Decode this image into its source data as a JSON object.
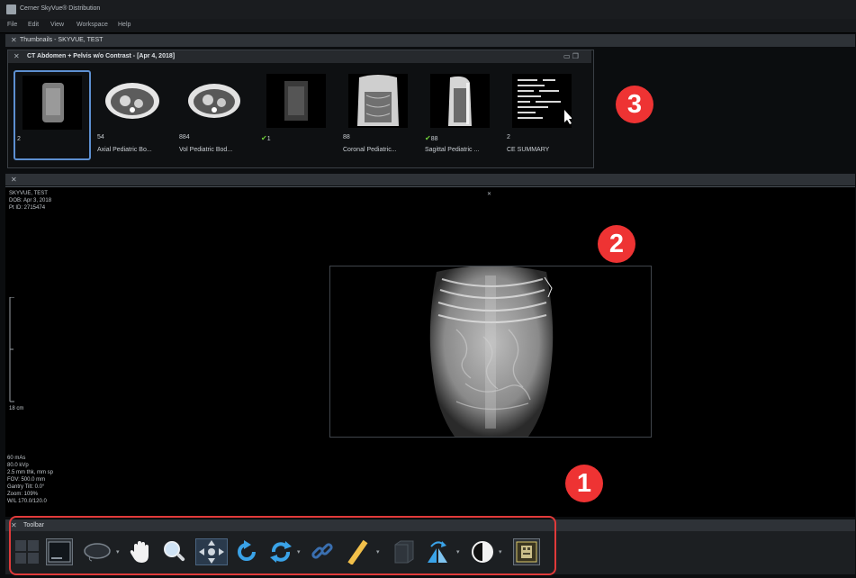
{
  "window": {
    "title": "Cerner SkyVue® Distribution"
  },
  "menu": [
    "File",
    "Edit",
    "View",
    "Workspace",
    "Help"
  ],
  "thumbnails_tab": {
    "label": "Thumbnails - SKYVUE, TEST"
  },
  "study": {
    "title": "CT Abdomen + Pelvis w/o Contrast - [Apr 4, 2018]"
  },
  "series": [
    {
      "count": "2",
      "label": "",
      "checked": false
    },
    {
      "count": "54",
      "label": "Axial Pediatric Bo...",
      "checked": false
    },
    {
      "count": "884",
      "label": "Vol Pediatric Bod...",
      "checked": false
    },
    {
      "count": "1",
      "label": "",
      "checked": true
    },
    {
      "count": "88",
      "label": "Coronal Pediatric...",
      "checked": false
    },
    {
      "count": "88",
      "label": "Sagittal Pediatric ...",
      "checked": true
    },
    {
      "count": "2",
      "label": "CE SUMMARY",
      "checked": false
    }
  ],
  "patient": {
    "name": "SKYVUE, TEST",
    "dob": "DOB: Apr 3, 2018",
    "pt_id": "Pt ID: 2715474"
  },
  "viewer": {
    "scale_label": "18 cm",
    "acquisition": [
      "60 mAs",
      "80.0 kVp",
      "2.5 mm thk, mm sp",
      "FOV: 500.0 mm",
      "Gantry Tilt: 0.0°",
      "Zoom: 109%",
      "W/L 170.0/120.0"
    ]
  },
  "toolbar": {
    "label": "Toolbar",
    "tools": [
      "layout-grid-icon",
      "single-view-icon",
      "lasso-icon",
      "pan-hand-icon",
      "magnify-icon",
      "navigate-icon",
      "rotate-icon",
      "sync-icon",
      "link-icon",
      "ruler-icon",
      "cube-icon",
      "flip-icon",
      "contrast-icon",
      "overlay-icon"
    ]
  },
  "callouts": [
    "1",
    "2",
    "3"
  ],
  "colors": {
    "callout": "#ee3333",
    "selection": "#5d8fd0",
    "check": "#6fcf3a"
  }
}
